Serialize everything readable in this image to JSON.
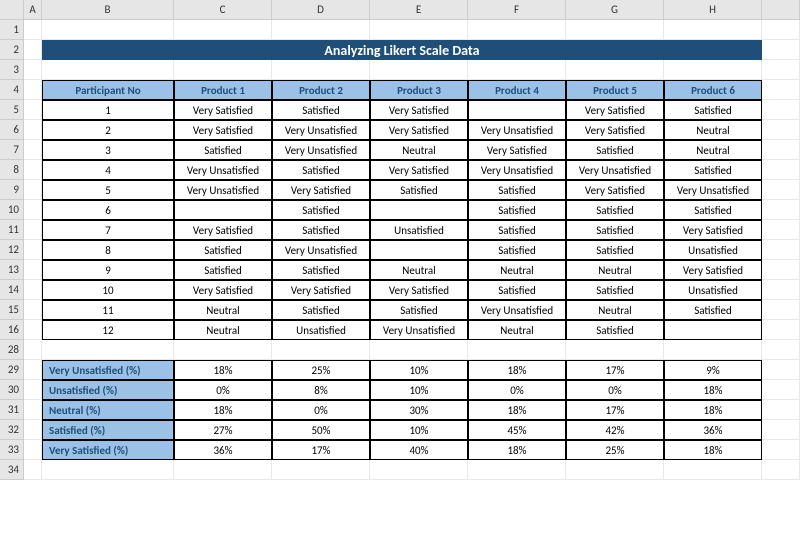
{
  "columns": [
    "A",
    "B",
    "C",
    "D",
    "E",
    "F",
    "G",
    "H"
  ],
  "row_labels_top": [
    "1",
    "2",
    "3",
    "4",
    "5",
    "6",
    "7",
    "8",
    "9",
    "10",
    "11",
    "12",
    "13",
    "14",
    "15",
    "16"
  ],
  "row_labels_bottom": [
    "28",
    "29",
    "30",
    "31",
    "32",
    "33",
    "34"
  ],
  "title": "Analyzing Likert Scale Data",
  "headers": {
    "participant": "Participant No",
    "p1": "Product 1",
    "p2": "Product 2",
    "p3": "Product 3",
    "p4": "Product 4",
    "p5": "Product 5",
    "p6": "Product 6"
  },
  "rows": [
    {
      "n": "1",
      "c": [
        "Very Satisfied",
        "Satisfied",
        "Very Satisfied",
        "",
        "Very Satisfied",
        "Satisfied"
      ]
    },
    {
      "n": "2",
      "c": [
        "Very Satisfied",
        "Very Unsatisfied",
        "Very Satisfied",
        "Very Unsatisfied",
        "Very Satisfied",
        "Neutral"
      ]
    },
    {
      "n": "3",
      "c": [
        "Satisfied",
        "Very Unsatisfied",
        "Neutral",
        "Very Satisfied",
        "Satisfied",
        "Neutral"
      ]
    },
    {
      "n": "4",
      "c": [
        "Very Unsatisfied",
        "Satisfied",
        "Very Satisfied",
        "Very Unsatisfied",
        "Very Unsatisfied",
        "Satisfied"
      ]
    },
    {
      "n": "5",
      "c": [
        "Very Unsatisfied",
        "Very Satisfied",
        "Satisfied",
        "Satisfied",
        "Very Satisfied",
        "Very Unsatisfied"
      ]
    },
    {
      "n": "6",
      "c": [
        "",
        "Satisfied",
        "",
        "Satisfied",
        "Satisfied",
        "Satisfied"
      ]
    },
    {
      "n": "7",
      "c": [
        "Very Satisfied",
        "Satisfied",
        "Unsatisfied",
        "Satisfied",
        "Satisfied",
        "Very Satisfied"
      ]
    },
    {
      "n": "8",
      "c": [
        "Satisfied",
        "Very Unsatisfied",
        "",
        "Satisfied",
        "Satisfied",
        "Unsatisfied"
      ]
    },
    {
      "n": "9",
      "c": [
        "Satisfied",
        "Satisfied",
        "Neutral",
        "Neutral",
        "Neutral",
        "Very Satisfied"
      ]
    },
    {
      "n": "10",
      "c": [
        "Very Satisfied",
        "Very Satisfied",
        "Very Satisfied",
        "Satisfied",
        "Satisfied",
        "Unsatisfied"
      ]
    },
    {
      "n": "11",
      "c": [
        "Neutral",
        "Satisfied",
        "Satisfied",
        "Very Unsatisfied",
        "Neutral",
        "Satisfied"
      ]
    },
    {
      "n": "12",
      "c": [
        "Neutral",
        "Unsatisfied",
        "Very Unsatisfied",
        "Neutral",
        "Satisfied",
        ""
      ]
    }
  ],
  "pct_labels": {
    "vu": "Very Unsatisfied (%)",
    "u": "Unsatisfied (%)",
    "n": "Neutral (%)",
    "s": "Satisfied (%)",
    "vs": "Very Satisfied (%)"
  },
  "pct": {
    "vu": [
      "18%",
      "25%",
      "10%",
      "18%",
      "17%",
      "9%"
    ],
    "u": [
      "0%",
      "8%",
      "10%",
      "0%",
      "0%",
      "18%"
    ],
    "n": [
      "18%",
      "0%",
      "30%",
      "18%",
      "17%",
      "18%"
    ],
    "s": [
      "27%",
      "50%",
      "10%",
      "45%",
      "42%",
      "36%"
    ],
    "vs": [
      "36%",
      "17%",
      "40%",
      "18%",
      "25%",
      "18%"
    ]
  },
  "chart_data": {
    "type": "table",
    "title": "Analyzing Likert Scale Data",
    "categories": [
      "Product 1",
      "Product 2",
      "Product 3",
      "Product 4",
      "Product 5",
      "Product 6"
    ],
    "series": [
      {
        "name": "Very Unsatisfied (%)",
        "values": [
          18,
          25,
          10,
          18,
          17,
          9
        ]
      },
      {
        "name": "Unsatisfied (%)",
        "values": [
          0,
          8,
          10,
          0,
          0,
          18
        ]
      },
      {
        "name": "Neutral (%)",
        "values": [
          18,
          0,
          30,
          18,
          17,
          18
        ]
      },
      {
        "name": "Satisfied (%)",
        "values": [
          27,
          50,
          10,
          45,
          42,
          36
        ]
      },
      {
        "name": "Very Satisfied (%)",
        "values": [
          36,
          17,
          40,
          18,
          25,
          18
        ]
      }
    ]
  }
}
